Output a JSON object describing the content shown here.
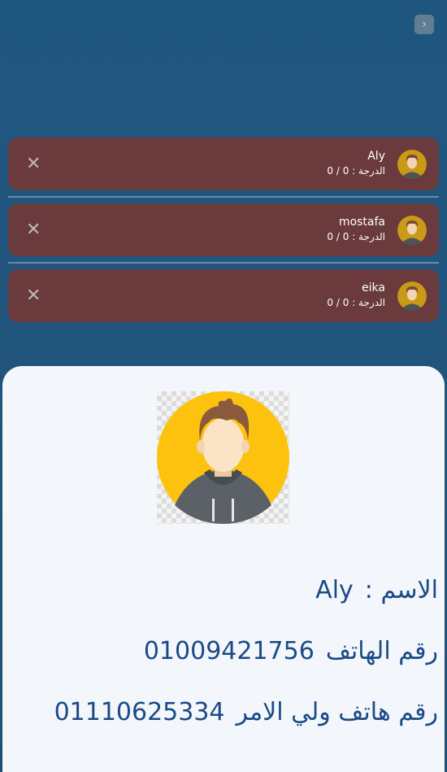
{
  "header": {
    "back_icon": "chevron-right-icon"
  },
  "students": [
    {
      "name": "Aly",
      "grade_label": "الدرجة :",
      "grade_value": "0 / 0"
    },
    {
      "name": "mostafa",
      "grade_label": "الدرجة :",
      "grade_value": "0 / 0"
    },
    {
      "name": "eika",
      "grade_label": "الدرجة :",
      "grade_value": "0 / 0"
    }
  ],
  "remove_icon": "close-icon",
  "detail": {
    "name_label": "الاسم :",
    "name_value": "Aly",
    "phone_label": "رقم الهاتف",
    "phone_value": "01009421756",
    "guardian_phone_label": "رقم هاتف ولي الامر",
    "guardian_phone_value": "01110625334"
  },
  "colors": {
    "background": "#1f5680",
    "card": "#6b3a3c",
    "sheet": "#f3f7fc",
    "text_accent": "#1b4a86",
    "avatar_bg": "#fdc20d"
  }
}
